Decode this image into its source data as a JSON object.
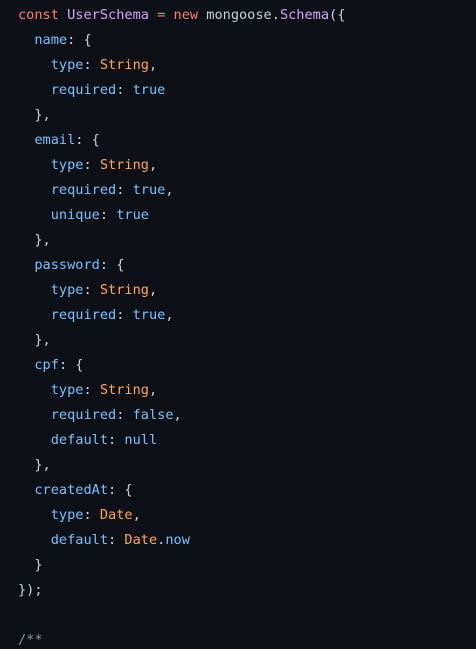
{
  "code": {
    "language": "javascript",
    "lines": [
      [
        {
          "t": "const ",
          "k": "keyword"
        },
        {
          "t": "UserSchema",
          "k": "class"
        },
        {
          "t": " ",
          "k": "plain"
        },
        {
          "t": "=",
          "k": "keyword"
        },
        {
          "t": " ",
          "k": "plain"
        },
        {
          "t": "new ",
          "k": "keyword"
        },
        {
          "t": "mongoose",
          "k": "plain"
        },
        {
          "t": ".",
          "k": "punct"
        },
        {
          "t": "Schema",
          "k": "class"
        },
        {
          "t": "({",
          "k": "punct"
        }
      ],
      [
        {
          "t": "  ",
          "k": "plain"
        },
        {
          "t": "name",
          "k": "prop"
        },
        {
          "t": ": {",
          "k": "punct"
        }
      ],
      [
        {
          "t": "    ",
          "k": "plain"
        },
        {
          "t": "type",
          "k": "prop"
        },
        {
          "t": ": ",
          "k": "punct"
        },
        {
          "t": "String",
          "k": "value"
        },
        {
          "t": ",",
          "k": "punct"
        }
      ],
      [
        {
          "t": "    ",
          "k": "plain"
        },
        {
          "t": "required",
          "k": "prop"
        },
        {
          "t": ": ",
          "k": "punct"
        },
        {
          "t": "true",
          "k": "const"
        }
      ],
      [
        {
          "t": "  ",
          "k": "plain"
        },
        {
          "t": "},",
          "k": "punct"
        }
      ],
      [
        {
          "t": "  ",
          "k": "plain"
        },
        {
          "t": "email",
          "k": "prop"
        },
        {
          "t": ": {",
          "k": "punct"
        }
      ],
      [
        {
          "t": "    ",
          "k": "plain"
        },
        {
          "t": "type",
          "k": "prop"
        },
        {
          "t": ": ",
          "k": "punct"
        },
        {
          "t": "String",
          "k": "value"
        },
        {
          "t": ",",
          "k": "punct"
        }
      ],
      [
        {
          "t": "    ",
          "k": "plain"
        },
        {
          "t": "required",
          "k": "prop"
        },
        {
          "t": ": ",
          "k": "punct"
        },
        {
          "t": "true",
          "k": "const"
        },
        {
          "t": ",",
          "k": "punct"
        }
      ],
      [
        {
          "t": "    ",
          "k": "plain"
        },
        {
          "t": "unique",
          "k": "prop"
        },
        {
          "t": ": ",
          "k": "punct"
        },
        {
          "t": "true",
          "k": "const"
        }
      ],
      [
        {
          "t": "  ",
          "k": "plain"
        },
        {
          "t": "},",
          "k": "punct"
        }
      ],
      [
        {
          "t": "  ",
          "k": "plain"
        },
        {
          "t": "password",
          "k": "prop"
        },
        {
          "t": ": {",
          "k": "punct"
        }
      ],
      [
        {
          "t": "    ",
          "k": "plain"
        },
        {
          "t": "type",
          "k": "prop"
        },
        {
          "t": ": ",
          "k": "punct"
        },
        {
          "t": "String",
          "k": "value"
        },
        {
          "t": ",",
          "k": "punct"
        }
      ],
      [
        {
          "t": "    ",
          "k": "plain"
        },
        {
          "t": "required",
          "k": "prop"
        },
        {
          "t": ": ",
          "k": "punct"
        },
        {
          "t": "true",
          "k": "const"
        },
        {
          "t": ",",
          "k": "punct"
        }
      ],
      [
        {
          "t": "  ",
          "k": "plain"
        },
        {
          "t": "},",
          "k": "punct"
        }
      ],
      [
        {
          "t": "  ",
          "k": "plain"
        },
        {
          "t": "cpf",
          "k": "prop"
        },
        {
          "t": ": {",
          "k": "punct"
        }
      ],
      [
        {
          "t": "    ",
          "k": "plain"
        },
        {
          "t": "type",
          "k": "prop"
        },
        {
          "t": ": ",
          "k": "punct"
        },
        {
          "t": "String",
          "k": "value"
        },
        {
          "t": ",",
          "k": "punct"
        }
      ],
      [
        {
          "t": "    ",
          "k": "plain"
        },
        {
          "t": "required",
          "k": "prop"
        },
        {
          "t": ": ",
          "k": "punct"
        },
        {
          "t": "false",
          "k": "const"
        },
        {
          "t": ",",
          "k": "punct"
        }
      ],
      [
        {
          "t": "    ",
          "k": "plain"
        },
        {
          "t": "default",
          "k": "prop"
        },
        {
          "t": ": ",
          "k": "punct"
        },
        {
          "t": "null",
          "k": "const"
        }
      ],
      [
        {
          "t": "  ",
          "k": "plain"
        },
        {
          "t": "},",
          "k": "punct"
        }
      ],
      [
        {
          "t": "  ",
          "k": "plain"
        },
        {
          "t": "createdAt",
          "k": "prop"
        },
        {
          "t": ": {",
          "k": "punct"
        }
      ],
      [
        {
          "t": "    ",
          "k": "plain"
        },
        {
          "t": "type",
          "k": "prop"
        },
        {
          "t": ": ",
          "k": "punct"
        },
        {
          "t": "Date",
          "k": "value"
        },
        {
          "t": ",",
          "k": "punct"
        }
      ],
      [
        {
          "t": "    ",
          "k": "plain"
        },
        {
          "t": "default",
          "k": "prop"
        },
        {
          "t": ": ",
          "k": "punct"
        },
        {
          "t": "Date",
          "k": "value"
        },
        {
          "t": ".",
          "k": "punct"
        },
        {
          "t": "now",
          "k": "prop"
        }
      ],
      [
        {
          "t": "  ",
          "k": "plain"
        },
        {
          "t": "}",
          "k": "punct"
        }
      ],
      [
        {
          "t": "});",
          "k": "punct"
        }
      ],
      [],
      [
        {
          "t": "/**",
          "k": "comment"
        }
      ]
    ]
  },
  "colors": {
    "background": "#0d1117",
    "keyword": "#ff7b72",
    "class": "#d2a8ff",
    "property": "#79c0ff",
    "value": "#ffa657",
    "constant": "#79c0ff",
    "plain": "#c9d1d9",
    "comment": "#8b949e"
  }
}
